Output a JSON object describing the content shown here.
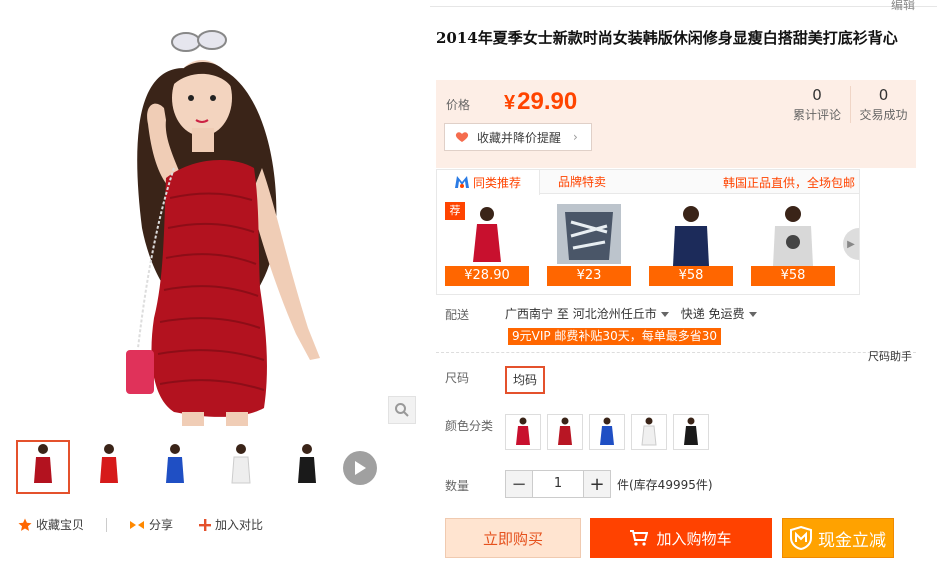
{
  "header": {
    "edit_label": "编辑"
  },
  "product": {
    "title": "2014年夏季女士新款时尚女装韩版休闲修身显瘦白搭甜美打底衫背心"
  },
  "price_box": {
    "price_label": "价格",
    "currency": "¥",
    "price": "29.90",
    "favorite_label": "收藏并降价提醒",
    "stats": [
      {
        "count": "0",
        "label": "累计评论"
      },
      {
        "count": "0",
        "label": "交易成功"
      }
    ]
  },
  "recommend": {
    "tabs": [
      {
        "label": "同类推荐"
      },
      {
        "label": "品牌特卖"
      }
    ],
    "note": "韩国正品直供，全场包邮",
    "badge": "荐",
    "items": [
      {
        "price": "¥28.90"
      },
      {
        "price": "¥23"
      },
      {
        "price": "¥58"
      },
      {
        "price": "¥58"
      }
    ]
  },
  "delivery": {
    "label": "配送",
    "from": "广西南宁",
    "to_word": "至",
    "to": "河北沧州任丘市",
    "method": "快递 免运费",
    "vip_promo": "9元VIP 邮费补贴30天，每单最多省30"
  },
  "size": {
    "label": "尺码",
    "help": "尺码助手",
    "options": [
      "均码"
    ]
  },
  "color": {
    "label": "颜色分类",
    "options": [
      "#c8102e",
      "#b81624",
      "#1f4fc4",
      "#f0f0f0",
      "#1a1a1a"
    ]
  },
  "quantity": {
    "label": "数量",
    "minus": "−",
    "value": "1",
    "plus": "+",
    "stock": "件(库存49995件)"
  },
  "buttons": {
    "buy_now": "立即购买",
    "add_cart": "加入购物车",
    "cash": "现金立减"
  },
  "gallery_actions": {
    "favorite": "收藏宝贝",
    "share": "分享",
    "compare": "加入对比"
  },
  "colors": {
    "accent": "#ff4400",
    "dress_red": "#b3121f",
    "price_bg": "#fdeee6"
  }
}
